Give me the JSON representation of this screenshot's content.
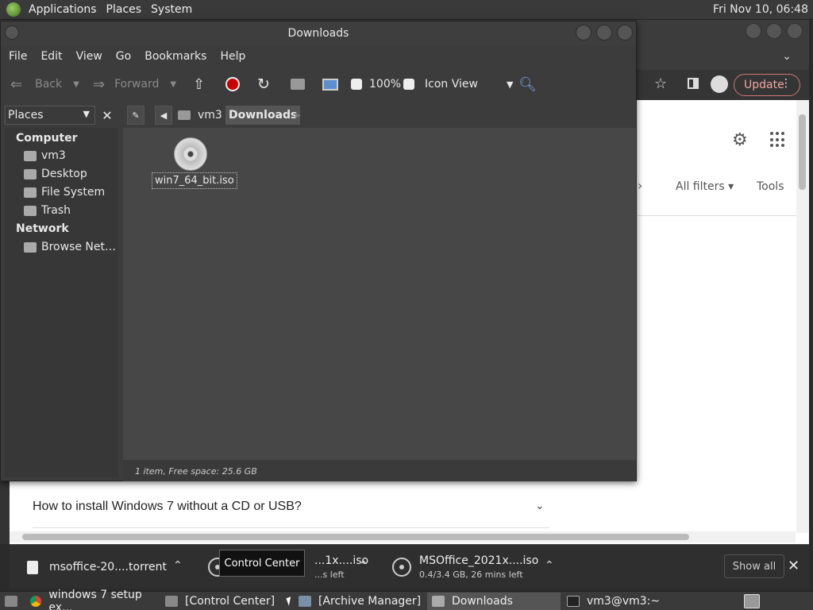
{
  "top_panel": {
    "menus": [
      "Applications",
      "Places",
      "System"
    ],
    "clock": "Fri Nov 10, 06:48"
  },
  "browser": {
    "update_label": "Update",
    "all_filters": "All filters",
    "tools": "Tools",
    "faq_question": "How to install Windows 7 without a CD or USB?"
  },
  "downloads_bar": {
    "items": [
      {
        "name": "msoffice-20....torrent",
        "status": ""
      },
      {
        "name": "...1x....iso",
        "status": "...s left"
      },
      {
        "name": "MSOffice_2021x....iso",
        "status": "0.4/3.4 GB, 26 mins left"
      }
    ],
    "show_all": "Show all",
    "tooltip": "Control Center"
  },
  "file_manager": {
    "title": "Downloads",
    "menus": [
      "File",
      "Edit",
      "View",
      "Go",
      "Bookmarks",
      "Help"
    ],
    "toolbar": {
      "back": "Back",
      "forward": "Forward",
      "zoom": "100%",
      "view_mode": "Icon View"
    },
    "sidebar_header": "Places",
    "breadcrumbs": [
      "vm3",
      "Downloads"
    ],
    "sidebar": {
      "computer_label": "Computer",
      "computer_items": [
        "vm3",
        "Desktop",
        "File System",
        "Trash"
      ],
      "network_label": "Network",
      "network_items": [
        "Browse Net…"
      ]
    },
    "files": [
      {
        "name": "win7_64_bit.iso",
        "icon": "disc-image-icon"
      }
    ],
    "status": "1 item, Free space: 25.6 GB"
  },
  "taskbar": {
    "tasks": [
      {
        "label": "windows 7 setup ex...",
        "active": false
      },
      {
        "label": "[Control Center]",
        "active": false
      },
      {
        "label": "[Archive Manager]",
        "active": false
      },
      {
        "label": "Downloads",
        "active": true
      },
      {
        "label": "vm3@vm3:~",
        "active": false
      }
    ]
  },
  "colors": {
    "panel_bg": "#3a3a3a",
    "window_bg": "#3c3c3c",
    "content_bg": "#474747",
    "update_accent": "#f3a6a6"
  }
}
